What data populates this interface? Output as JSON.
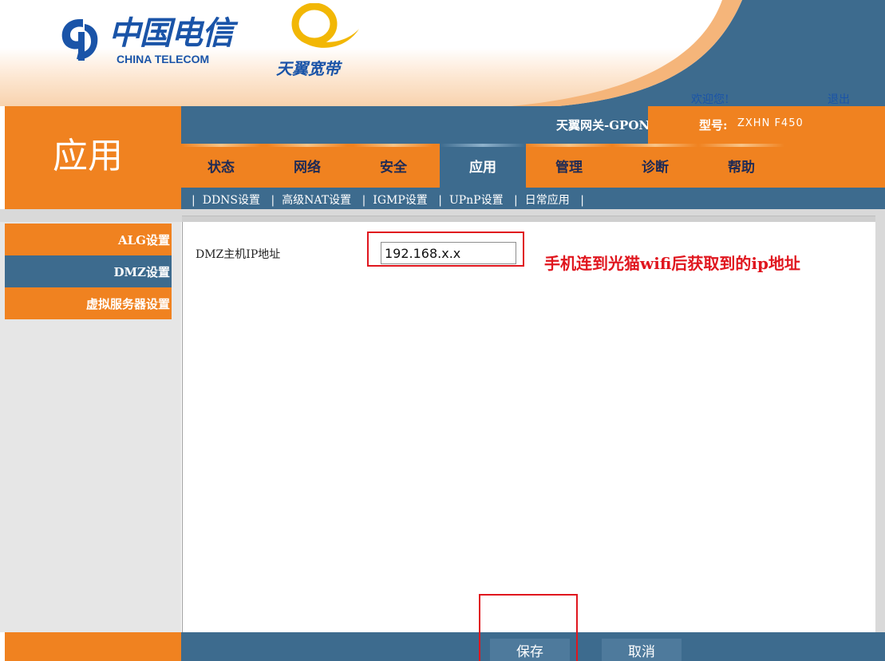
{
  "header": {
    "logo_cn": "中国电信",
    "logo_en": "CHINA TELECOM",
    "brand": "天翼宽带",
    "welcome": "欢迎您!",
    "logout": "退出"
  },
  "section_title": "应用",
  "gateway": {
    "name": "天翼网关-GPON",
    "model_label": "型号:",
    "model_value": "ZXHN F450"
  },
  "tabs": [
    {
      "label": "状态",
      "active": false
    },
    {
      "label": "网络",
      "active": false
    },
    {
      "label": "安全",
      "active": false
    },
    {
      "label": "应用",
      "active": true
    },
    {
      "label": "管理",
      "active": false
    },
    {
      "label": "诊断",
      "active": false
    },
    {
      "label": "帮助",
      "active": false
    }
  ],
  "subnav": [
    "DDNS设置",
    "高级NAT设置",
    "IGMP设置",
    "UPnP设置",
    "日常应用"
  ],
  "sidebar": [
    {
      "label": "ALG设置",
      "active": false
    },
    {
      "label": "DMZ设置",
      "active": true
    },
    {
      "label": "虚拟服务器设置",
      "active": false
    }
  ],
  "form": {
    "dmz_label": "DMZ主机IP地址",
    "dmz_value": "192.168.x.x"
  },
  "annotation": "手机连到光猫wifi后获取到的ip地址",
  "footer": {
    "save": "保存",
    "cancel": "取消"
  },
  "colors": {
    "orange": "#f08220",
    "blue": "#3d6b8e",
    "annotation_red": "#e0161e",
    "logo_blue": "#1a54a8"
  }
}
